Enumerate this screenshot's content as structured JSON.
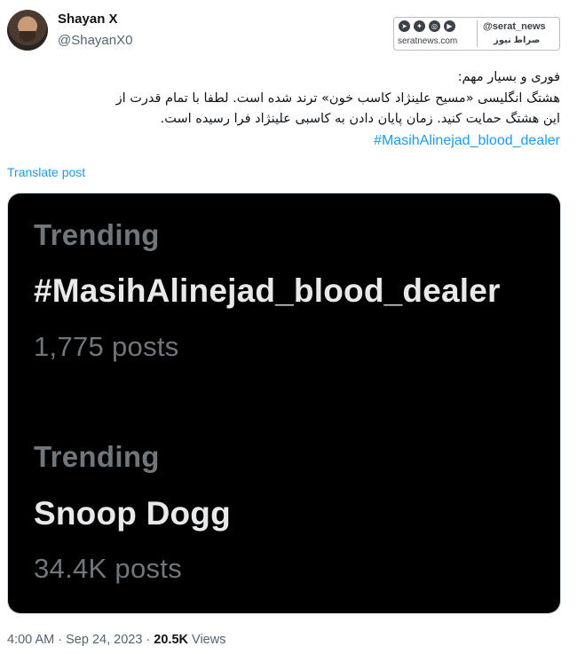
{
  "author": {
    "display_name": "Shayan X",
    "handle": "@ShayanX0"
  },
  "watermark": {
    "icons": [
      "telegram-icon",
      "twitter-icon",
      "instagram-icon",
      "youtube-icon"
    ],
    "site": "seratnews.com",
    "handle": "@serat_news",
    "brand": "صراط نیوز"
  },
  "tweet": {
    "lines": [
      "فوری و بسیار مهم:",
      "هشتگ انگلیسی «مسیح علینژاد کاسب خون» ترند شده است. لطفا با تمام قدرت از",
      "این هشتگ حمایت کنید. زمان پایان دادن به کاسبی علینژاد فرا رسیده است."
    ],
    "hashtag": "#MasihAlinejad_blood_dealer"
  },
  "translate_label": "Translate post",
  "media": {
    "trends": [
      {
        "label": "Trending",
        "name": "#MasihAlinejad_blood_dealer",
        "count": "1,775 posts"
      },
      {
        "label": "Trending",
        "name": "Snoop Dogg",
        "count": "34.4K posts"
      }
    ]
  },
  "meta": {
    "time": "4:00 AM",
    "separator": "·",
    "date": "Sep 24, 2023",
    "views_count": "20.5K",
    "views_label": "Views"
  }
}
